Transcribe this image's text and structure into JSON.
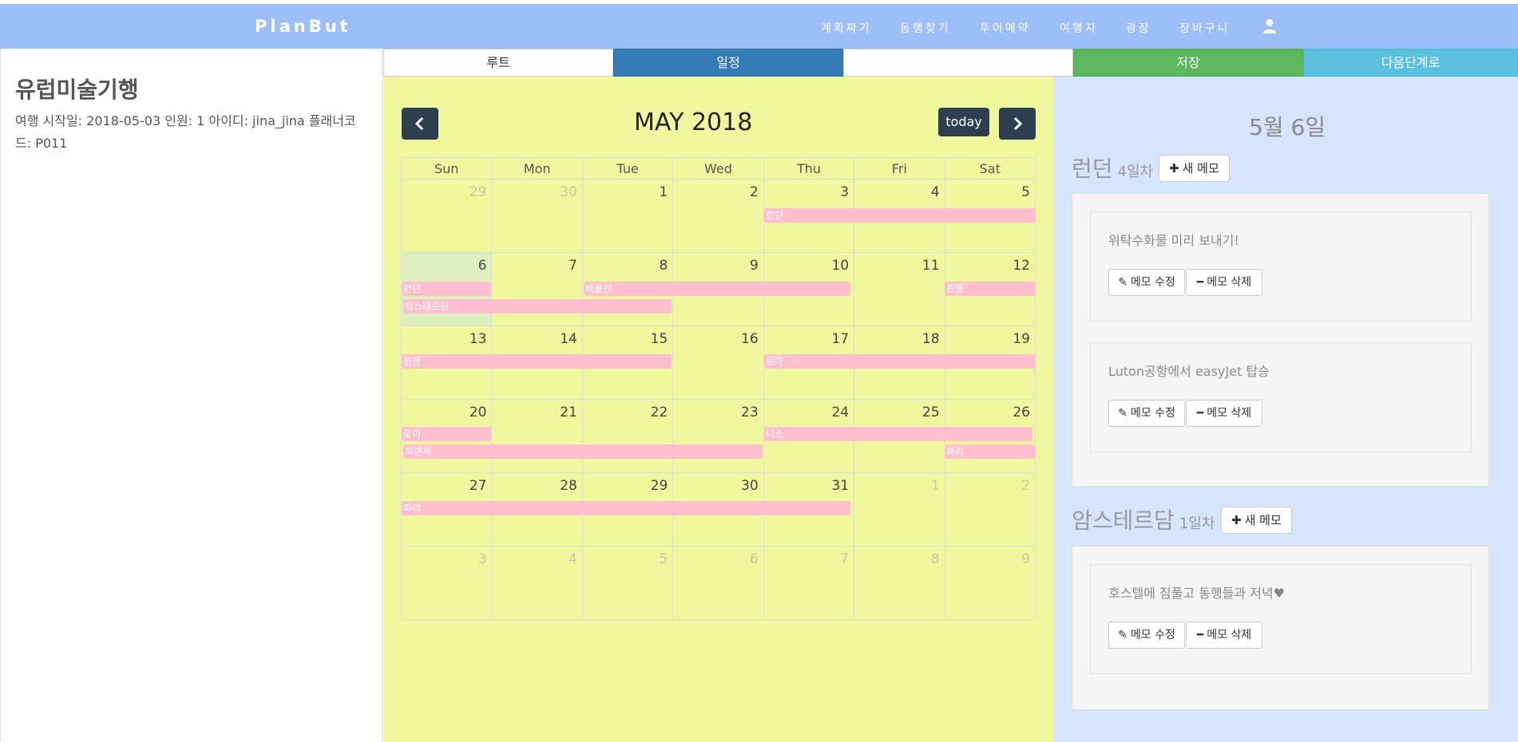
{
  "navbar": {
    "brand": "PlanBut",
    "items": [
      "계획짜기",
      "동행찾기",
      "투어예약",
      "여행지",
      "광장",
      "장바구니"
    ],
    "user_icon": "user-icon"
  },
  "trip": {
    "title": "유럽미술기행",
    "info": "여행 시작일: 2018-05-03 인원: 1 아이디: jina_jina 플래너코드: P011"
  },
  "tabs": {
    "route": "루트",
    "schedule": "일정",
    "save": "저장",
    "next": "다음단계로"
  },
  "calendar": {
    "title": "MAY 2018",
    "today_label": "today",
    "prev_icon": "chevron-left-icon",
    "next_icon": "chevron-right-icon",
    "weekdays": [
      "Sun",
      "Mon",
      "Tue",
      "Wed",
      "Thu",
      "Fri",
      "Sat"
    ],
    "weeks": [
      [
        "29",
        "30",
        "1",
        "2",
        "3",
        "4",
        "5"
      ],
      [
        "6",
        "7",
        "8",
        "9",
        "10",
        "11",
        "12"
      ],
      [
        "13",
        "14",
        "15",
        "16",
        "17",
        "18",
        "19"
      ],
      [
        "20",
        "21",
        "22",
        "23",
        "24",
        "25",
        "26"
      ],
      [
        "27",
        "28",
        "29",
        "30",
        "31",
        "1",
        "2"
      ],
      [
        "3",
        "4",
        "5",
        "6",
        "7",
        "8",
        "9"
      ]
    ],
    "events": [
      {
        "label": "런던"
      },
      {
        "label": "런던"
      },
      {
        "label": "베를린"
      },
      {
        "label": "뮌헨"
      },
      {
        "label": "암스테르담"
      },
      {
        "label": "뮌헨"
      },
      {
        "label": "로마"
      },
      {
        "label": "로마"
      },
      {
        "label": "니스"
      },
      {
        "label": "피렌체"
      },
      {
        "label": "파리"
      },
      {
        "label": "파리"
      }
    ]
  },
  "memo_panel": {
    "selected_date": "5월 6일",
    "new_memo_label": "새 메모",
    "edit_label": "메모 수정",
    "delete_label": "메모 삭제",
    "groups": [
      {
        "city": "런던",
        "day": "4일차",
        "memos": [
          "위탁수화물 미리 보내기!",
          "Luton공항에서 easyJet 탑승"
        ]
      },
      {
        "city": "암스테르담",
        "day": "1일차",
        "memos": [
          "호스텔에 짐풀고 동행들과 저녁♥"
        ]
      }
    ]
  },
  "colors": {
    "navbar": "#9cbffa",
    "calendar_bg": "#f0f89f",
    "event": "#ffbfcf",
    "memo_panel_bg": "#d6e4fd",
    "schedule_tab": "#337ab7",
    "save_tab": "#5cb85c",
    "next_tab": "#5bc0de"
  }
}
